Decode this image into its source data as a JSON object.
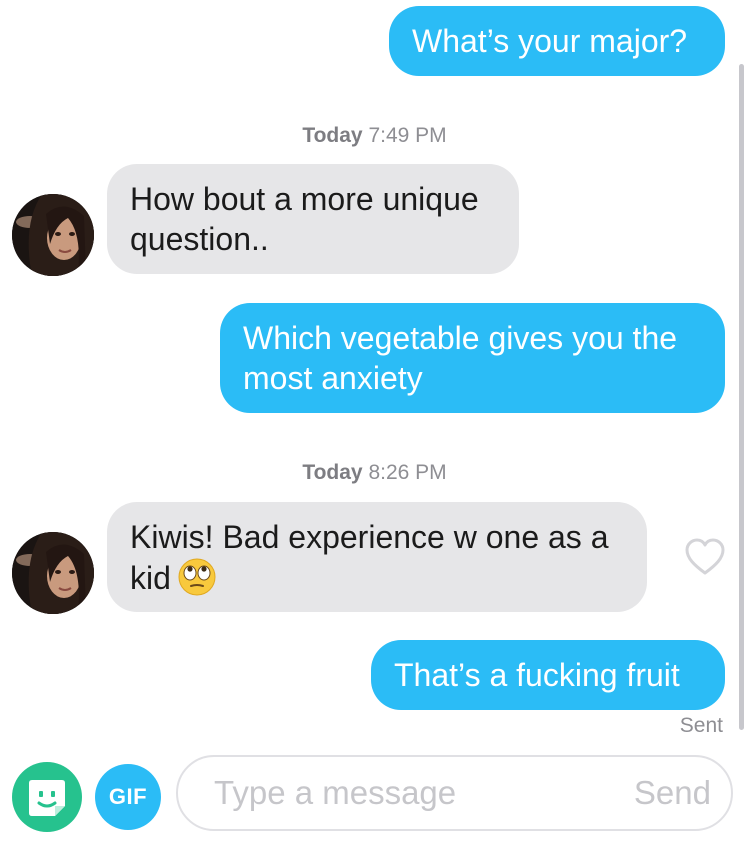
{
  "colors": {
    "outgoing_bubble": "#2bbcf6",
    "incoming_bubble": "#e6e6e8",
    "sticker_button": "#26c28e",
    "gif_button": "#2bbcf6"
  },
  "messages": [
    {
      "direction": "outgoing",
      "text": "What’s your major?"
    },
    {
      "direction": "incoming",
      "text": "How bout a more unique question.."
    },
    {
      "direction": "outgoing",
      "text": "Which vegetable gives you the most anxiety"
    },
    {
      "direction": "incoming",
      "text": "Kiwis! Bad experience w one as a kid",
      "emoji": "face-with-rolling-eyes"
    },
    {
      "direction": "outgoing",
      "text": "That’s a fucking fruit"
    }
  ],
  "timestamps": [
    {
      "day": "Today",
      "time": "7:49 PM"
    },
    {
      "day": "Today",
      "time": "8:26 PM"
    }
  ],
  "status": {
    "sent": "Sent"
  },
  "icons": {
    "like": "heart-outline-icon",
    "sticker": "sticker-face-icon",
    "emoji": "rolling-eyes-emoji"
  },
  "composer": {
    "gif_label": "GIF",
    "placeholder": "Type a message",
    "value": "",
    "send_label": "Send"
  }
}
